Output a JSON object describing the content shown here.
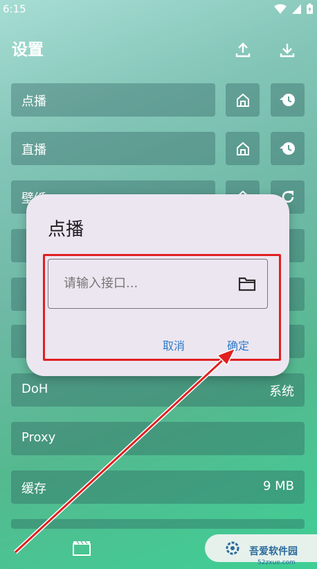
{
  "status": {
    "time": "6:15"
  },
  "page": {
    "title": "设置"
  },
  "settings": {
    "rows": [
      {
        "label": "点播",
        "value": ""
      },
      {
        "label": "直播",
        "value": ""
      },
      {
        "label": "壁纸",
        "value": ""
      },
      {
        "label": "",
        "value": ""
      },
      {
        "label": "",
        "value": ""
      },
      {
        "label": "",
        "value": ""
      },
      {
        "label": "DoH",
        "value": "系统"
      },
      {
        "label": "Proxy",
        "value": ""
      },
      {
        "label": "缓存",
        "value": "9 MB"
      },
      {
        "label": "",
        "value": ""
      }
    ]
  },
  "dialog": {
    "title": "点播",
    "input_placeholder": "请输入接口...",
    "cancel_label": "取消",
    "confirm_label": "确定"
  },
  "watermark": {
    "text": "吾爱软件园",
    "sub": "52zxue.com"
  },
  "colors": {
    "accent": "#2e7bc7",
    "highlight": "#e02020",
    "dialog_bg": "#ece6f0"
  }
}
